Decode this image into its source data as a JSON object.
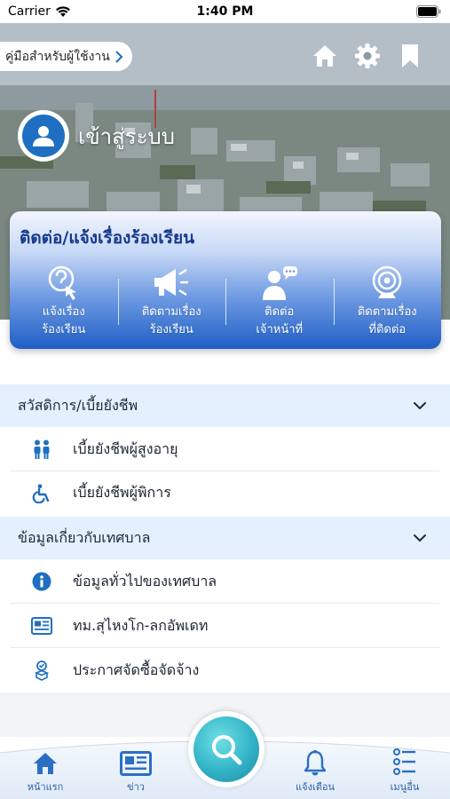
{
  "status_bar": {
    "carrier": "Carrier",
    "time": "1:40 PM"
  },
  "header": {
    "guide_label": "คู่มือสำหรับผู้ใช้งาน",
    "icons": [
      "home-icon",
      "gear-icon",
      "bookmark-icon"
    ],
    "login_label": "เข้าสู่ระบบ"
  },
  "contact_card": {
    "title": "ติดต่อ/แจ้งเรื่องร้องเรียน",
    "items": [
      {
        "line1": "แจ้งเรื่อง",
        "line2": "ร้องเรียน",
        "icon": "touch-question-icon"
      },
      {
        "line1": "ติดตามเรื่อง",
        "line2": "ร้องเรียน",
        "icon": "megaphone-icon"
      },
      {
        "line1": "ติดต่อ",
        "line2": "เจ้าหน้าที่",
        "icon": "staff-chat-icon"
      },
      {
        "line1": "ติดตามเรื่อง",
        "line2": "ที่ติดต่อ",
        "icon": "webcam-icon"
      }
    ]
  },
  "sections": [
    {
      "title": "สวัสดิการ/เบี้ยยังชีพ",
      "items": [
        {
          "label": "เบี้ยยังชีพผู้สูงอายุ",
          "icon": "elderly-couple-icon"
        },
        {
          "label": "เบี้ยยังชีพผู้พิการ",
          "icon": "wheelchair-icon"
        }
      ]
    },
    {
      "title": "ข้อมูลเกี่ยวกับเทศบาล",
      "items": [
        {
          "label": "ข้อมูลทั่วไปของเทศบาล",
          "icon": "info-icon"
        },
        {
          "label": "ทม.สุไหงโก-ลกอัพเดท",
          "icon": "newspaper-icon"
        },
        {
          "label": "ประกาศจัดซื้อจัดจ้าง",
          "icon": "procurement-icon"
        }
      ]
    }
  ],
  "tabbar": {
    "home": "หน้าแรก",
    "news": "ข่าว",
    "notifications": "แจ้งเตือน",
    "more": "เมนูอื่น"
  },
  "colors": {
    "accent": "#1e6fc1",
    "section_bg": "#e4f0fd",
    "tab_label": "#2a5fa8",
    "search_fab": "#33b3c8"
  }
}
